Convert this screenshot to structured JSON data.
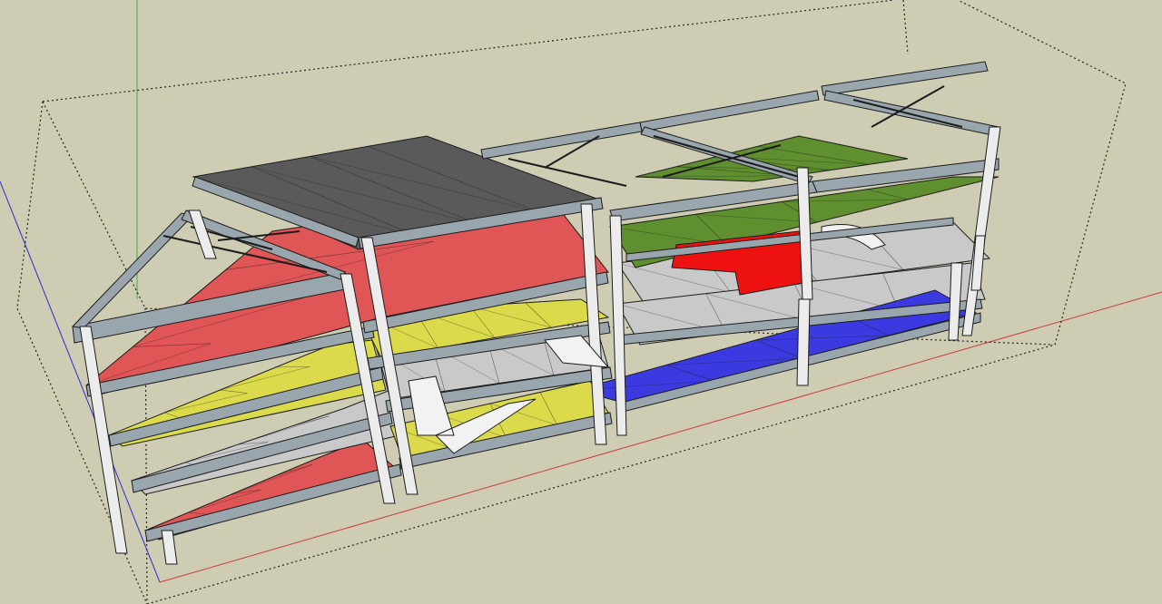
{
  "viewport": {
    "background": "#cfccb4",
    "axes": {
      "red": "#cc3a3a",
      "green": "#36b34a",
      "blue": "#2a2ad0"
    },
    "bounding_box_color": "#222222"
  },
  "model": {
    "floor_colors": {
      "roof_dark": "#5a5a5a",
      "red": "#e05555",
      "yellow": "#dada4a",
      "light_gray": "#c9c9c9",
      "green": "#5f8f2e",
      "blue": "#3a3ae0",
      "red_core": "#ee1111"
    },
    "beam_color": "#9aa6ad",
    "column_color": "#ececec",
    "outline_color": "#1c1c1c"
  }
}
